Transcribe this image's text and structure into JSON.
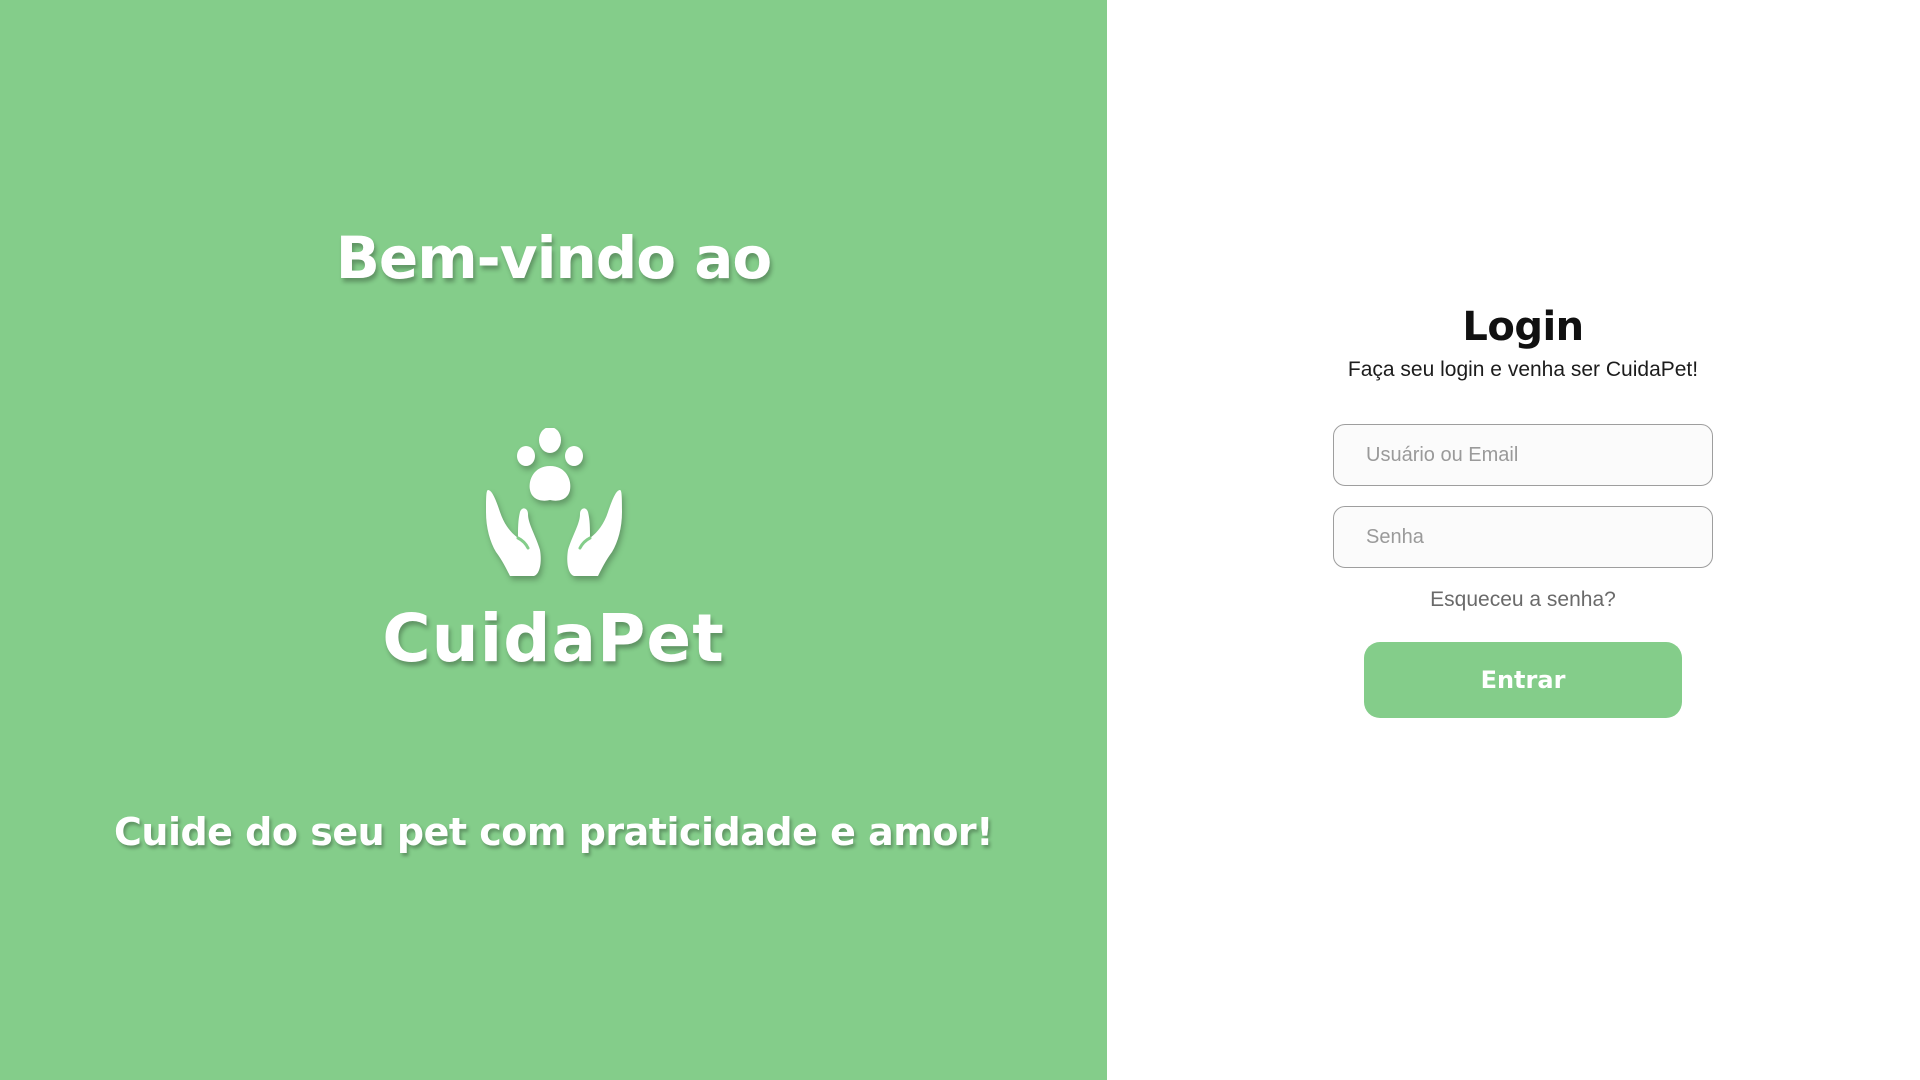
{
  "colors": {
    "brand_green": "#84cd8a",
    "background_right": "#ffffff",
    "title_text": "#111111",
    "placeholder_text": "#9a9a9a",
    "link_text": "#6a6a6a"
  },
  "left": {
    "welcome": "Bem-vindo ao",
    "logo_icon": "hands-paw-icon",
    "brand_name": "CuidaPet",
    "tagline": "Cuide do seu pet com praticidade e amor!"
  },
  "login": {
    "title": "Login",
    "subtitle": "Faça seu login e venha ser CuidaPet!",
    "username_placeholder": "Usuário ou Email",
    "password_placeholder": "Senha",
    "forgot_label": "Esqueceu a senha?",
    "submit_label": "Entrar"
  }
}
